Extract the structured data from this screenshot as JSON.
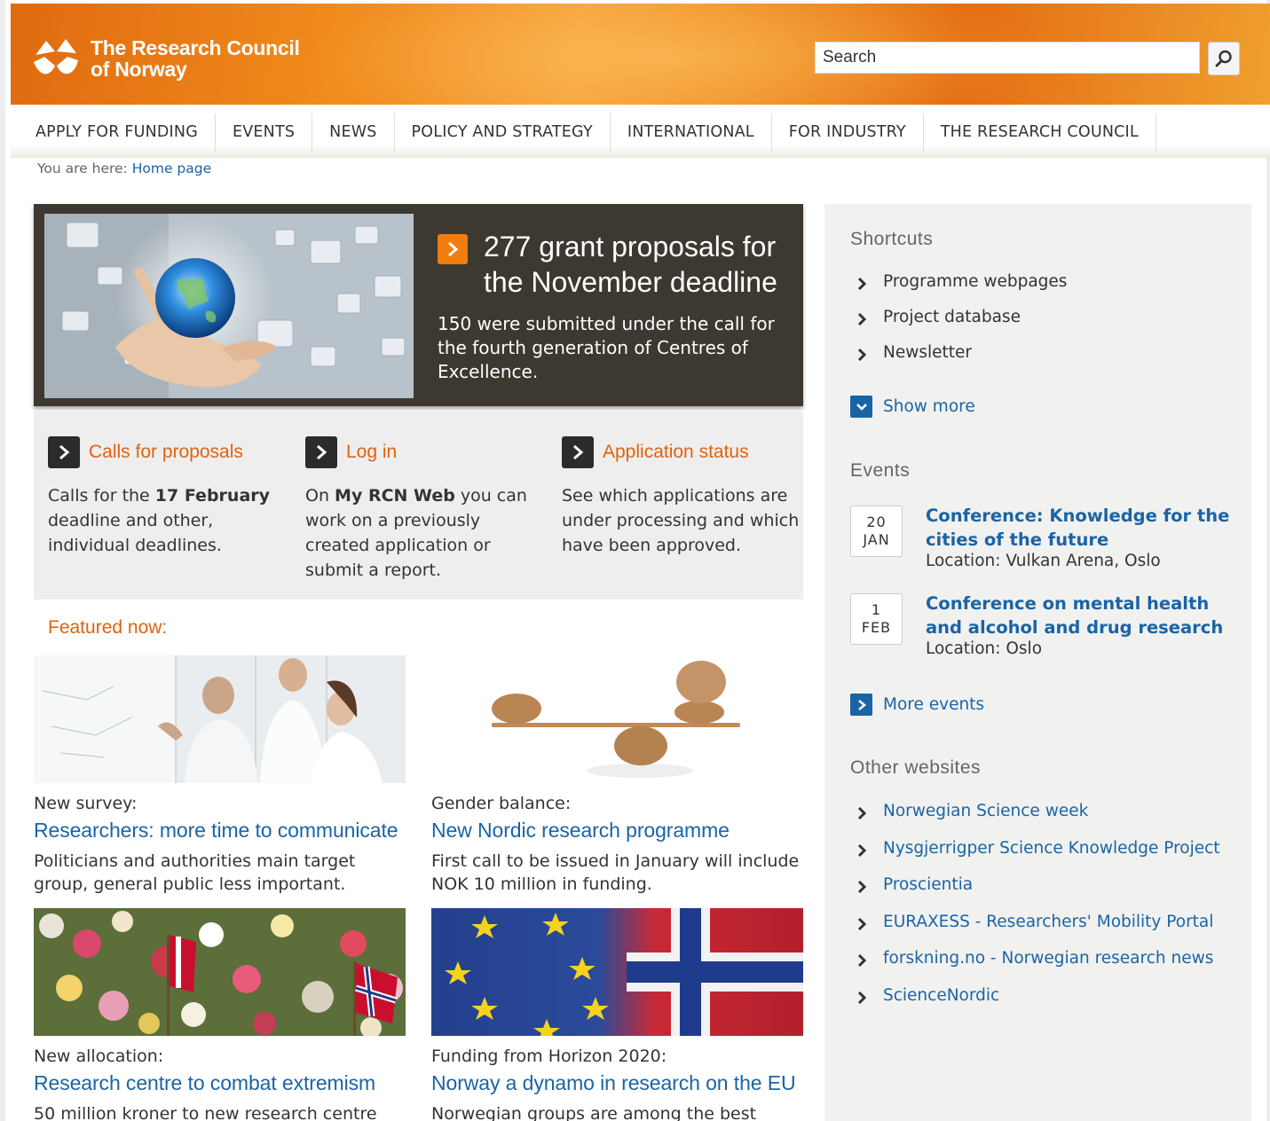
{
  "header": {
    "logo_line1": "The Research Council",
    "logo_line2": "of Norway",
    "search_placeholder": "Search"
  },
  "nav": {
    "items": [
      "APPLY FOR FUNDING",
      "EVENTS",
      "NEWS",
      "POLICY AND STRATEGY",
      "INTERNATIONAL",
      "FOR INDUSTRY",
      "THE RESEARCH COUNCIL"
    ]
  },
  "breadcrumb": {
    "prefix": "You are here:",
    "home": "Home page"
  },
  "hero": {
    "title": "277 grant proposals for the November deadline",
    "description": "150 were submitted under the call for the fourth generation of Centres of Excellence."
  },
  "actions": [
    {
      "title": "Calls for proposals",
      "desc_pre": "Calls for the ",
      "desc_bold": "17 February",
      "desc_post": " deadline and other, individual deadlines."
    },
    {
      "title": "Log in",
      "desc_pre": "On ",
      "desc_bold": "My RCN Web",
      "desc_post": " you can work on a previously created application or submit a report."
    },
    {
      "title": "Application status",
      "desc_pre": "See which applications are under processing and which have been approved.",
      "desc_bold": "",
      "desc_post": ""
    }
  ],
  "featured": {
    "label": "Featured now:",
    "cards": [
      {
        "kicker": "New survey:",
        "title": "Researchers: more time to communicate",
        "desc": "Politicians and authorities main target group, general public less important."
      },
      {
        "kicker": "Gender balance:",
        "title": "New Nordic research programme",
        "desc": "First call to be issued in January will include NOK 10 million in funding."
      },
      {
        "kicker": "New allocation:",
        "title": "Research centre to combat extremism",
        "desc": "50 million kroner to new research centre"
      },
      {
        "kicker": "Funding from Horizon 2020:",
        "title": "Norway a dynamo in research on the EU",
        "desc": "Norwegian groups are among the best"
      }
    ]
  },
  "sidebar": {
    "shortcuts_heading": "Shortcuts",
    "shortcuts": [
      "Programme webpages",
      "Project database",
      "Newsletter"
    ],
    "show_more": "Show more",
    "events_heading": "Events",
    "events": [
      {
        "day": "20",
        "month": "JAN",
        "title": "Conference: Knowledge for the cities of the future",
        "location": "Location: Vulkan Arena, Oslo"
      },
      {
        "day": "1",
        "month": "FEB",
        "title": "Conference on mental health and alcohol and drug research",
        "location": "Location: Oslo"
      }
    ],
    "more_events": "More events",
    "other_heading": "Other websites",
    "other_sites": [
      "Norwegian Science week",
      "Nysgjerrigper Science Knowledge Project",
      "Proscientia",
      "EURAXESS - Researchers' Mobility Portal",
      "forskning.no - Norwegian research news",
      "ScienceNordic"
    ]
  },
  "colors": {
    "brand_orange": "#e0620f",
    "link_blue": "#1a64a6",
    "hero_bg": "#3d3830"
  }
}
